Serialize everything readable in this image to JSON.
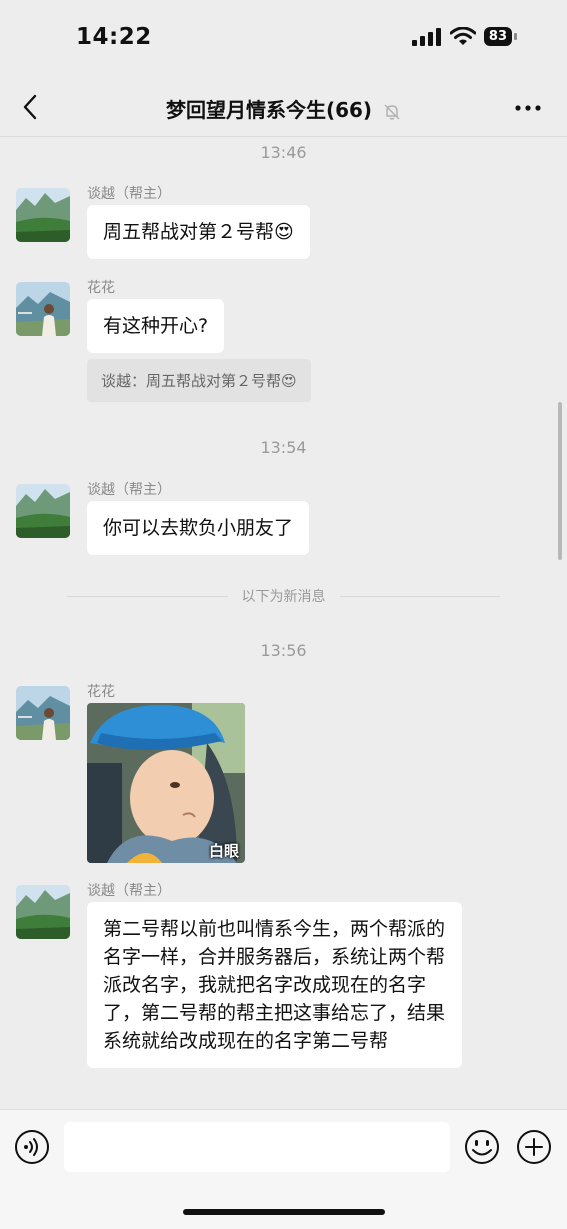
{
  "status_bar": {
    "time": "14:22",
    "battery": "83"
  },
  "nav": {
    "title": "梦回望月情系今生(66)"
  },
  "messages": [
    {
      "type": "time",
      "text": "13:46"
    },
    {
      "type": "text",
      "sender": "谈越（帮主）",
      "text": "周五帮战对第２号帮😍"
    },
    {
      "type": "text",
      "sender": "花花",
      "text": "有这种开心?"
    },
    {
      "type": "quote",
      "text": "谈越：周五帮战对第２号帮😍"
    },
    {
      "type": "time",
      "text": "13:54"
    },
    {
      "type": "text",
      "sender": "谈越（帮主）",
      "text": "你可以去欺负小朋友了"
    },
    {
      "type": "divider",
      "text": "以下为新消息"
    },
    {
      "type": "time",
      "text": "13:56"
    },
    {
      "type": "sticker",
      "sender": "花花",
      "caption": "白眼"
    },
    {
      "type": "text",
      "sender": "谈越（帮主）",
      "text": "第二号帮以前也叫情系今生，两个帮派的名字一样，合并服务器后，系统让两个帮派改名字，我就把名字改成现在的名字了，第二号帮的帮主把这事给忘了，结果系统就给改成现在的名字第二号帮"
    }
  ],
  "input": {
    "value": ""
  },
  "colors": {
    "background": "#ededed",
    "bubble": "#ffffff",
    "quote": "#e2e2e2"
  }
}
